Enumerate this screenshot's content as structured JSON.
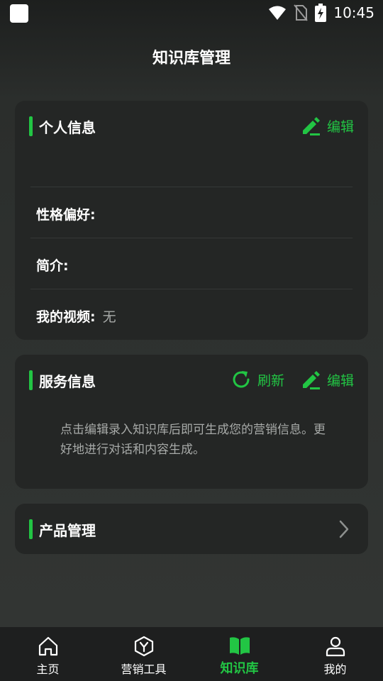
{
  "status_bar": {
    "time": "10:45",
    "icons": [
      "app-square-icon",
      "wifi-icon",
      "no-sim-icon",
      "battery-charging-icon"
    ]
  },
  "page": {
    "title": "知识库管理"
  },
  "personal_card": {
    "title": "个人信息",
    "edit_label": "编辑",
    "fields": [
      {
        "label": "性格偏好:",
        "value": ""
      },
      {
        "label": "简介:",
        "value": ""
      },
      {
        "label": "我的视频:",
        "value": "无"
      }
    ]
  },
  "service_card": {
    "title": "服务信息",
    "refresh_label": "刷新",
    "edit_label": "编辑",
    "description": "点击编辑录入知识库后即可生成您的营销信息。更好地进行对话和内容生成。"
  },
  "product_card": {
    "title": "产品管理"
  },
  "bottom_nav": {
    "items": [
      {
        "label": "主页",
        "icon": "home-icon",
        "active": false
      },
      {
        "label": "营销工具",
        "icon": "hexagon-y-icon",
        "active": false
      },
      {
        "label": "知识库",
        "icon": "book-icon",
        "active": true
      },
      {
        "label": "我的",
        "icon": "user-icon",
        "active": false
      }
    ]
  },
  "colors": {
    "accent": "#22c544",
    "card_bg": "#242625",
    "nav_bg": "#1e1f1f",
    "muted_text": "#a7aaa8"
  }
}
